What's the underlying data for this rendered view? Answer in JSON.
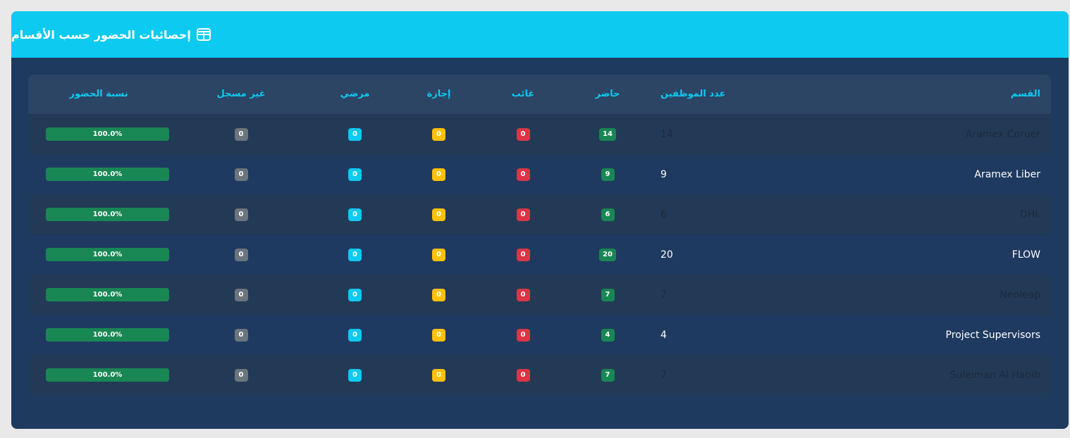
{
  "card": {
    "title": "إحصائيات الحضور حسب الأقسام",
    "icon": "table-icon"
  },
  "columns": {
    "dept": "القسم",
    "count": "عدد الموظفين",
    "present": "حاضر",
    "absent": "غائب",
    "leave": "إجازة",
    "sick": "مرضي",
    "unregistered": "غير مسجل",
    "rate": "نسبة الحضور"
  },
  "rows": [
    {
      "dept": "Aramex Coruer",
      "count": "14",
      "present": "14",
      "absent": "0",
      "leave": "0",
      "sick": "0",
      "unregistered": "0",
      "rate": "100.0%",
      "rate_value": 100
    },
    {
      "dept": "Aramex Liber",
      "count": "9",
      "present": "9",
      "absent": "0",
      "leave": "0",
      "sick": "0",
      "unregistered": "0",
      "rate": "100.0%",
      "rate_value": 100
    },
    {
      "dept": "DHL",
      "count": "6",
      "present": "6",
      "absent": "0",
      "leave": "0",
      "sick": "0",
      "unregistered": "0",
      "rate": "100.0%",
      "rate_value": 100
    },
    {
      "dept": "FLOW",
      "count": "20",
      "present": "20",
      "absent": "0",
      "leave": "0",
      "sick": "0",
      "unregistered": "0",
      "rate": "100.0%",
      "rate_value": 100
    },
    {
      "dept": "Neoleap",
      "count": "7",
      "present": "7",
      "absent": "0",
      "leave": "0",
      "sick": "0",
      "unregistered": "0",
      "rate": "100.0%",
      "rate_value": 100
    },
    {
      "dept": "Project Supervisors",
      "count": "4",
      "present": "4",
      "absent": "0",
      "leave": "0",
      "sick": "0",
      "unregistered": "0",
      "rate": "100.0%",
      "rate_value": 100
    },
    {
      "dept": "Suleiman Al Habib",
      "count": "7",
      "present": "7",
      "absent": "0",
      "leave": "0",
      "sick": "0",
      "unregistered": "0",
      "rate": "100.0%",
      "rate_value": 100
    }
  ],
  "colors": {
    "header": "#0dcaf0",
    "card_bg": "#1e3a5f",
    "present": "#198754",
    "absent": "#dc3545",
    "leave": "#ffc107",
    "sick": "#0dcaf0",
    "unregistered": "#6c757d"
  }
}
